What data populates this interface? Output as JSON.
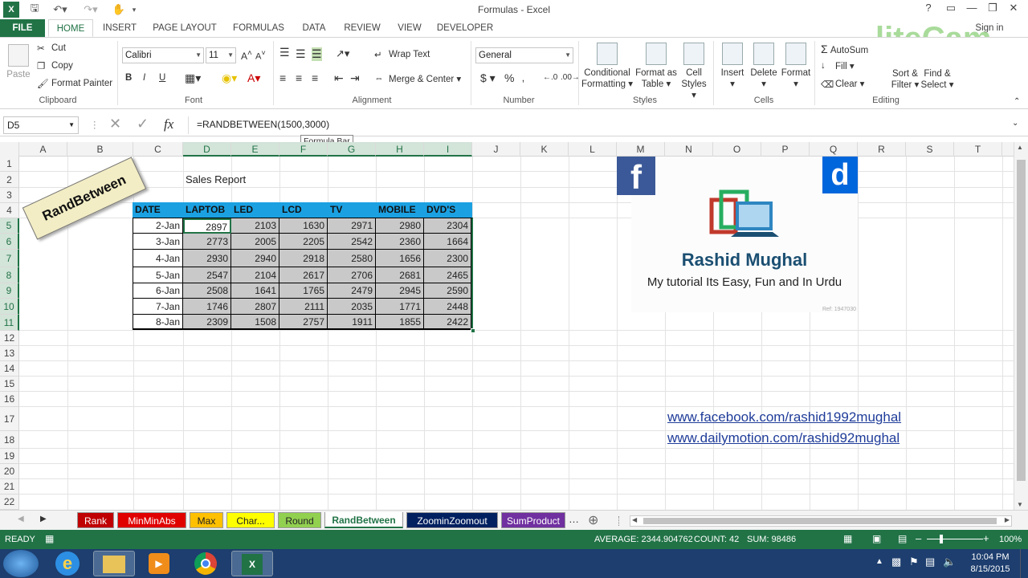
{
  "window": {
    "title": "Formulas - Excel",
    "signin": "Sign in"
  },
  "ribbon_tabs": [
    "FILE",
    "HOME",
    "INSERT",
    "PAGE LAYOUT",
    "FORMULAS",
    "DATA",
    "REVIEW",
    "VIEW",
    "DEVELOPER"
  ],
  "clipboard": {
    "paste": "Paste",
    "cut": "Cut",
    "copy": "Copy",
    "format_painter": "Format Painter",
    "label": "Clipboard"
  },
  "font": {
    "name": "Calibri",
    "size": "11",
    "label": "Font",
    "bold": "B",
    "italic": "I",
    "underline": "U"
  },
  "alignment": {
    "wrap": "Wrap Text",
    "merge": "Merge & Center",
    "label": "Alignment"
  },
  "number": {
    "format": "General",
    "label": "Number",
    "currency": "$",
    "percent": "%"
  },
  "styles": {
    "conditional": [
      "Conditional",
      "Formatting"
    ],
    "format_table": [
      "Format as",
      "Table"
    ],
    "cell_styles": [
      "Cell",
      "Styles"
    ],
    "label": "Styles"
  },
  "cells": {
    "insert": "Insert",
    "delete": "Delete",
    "format": "Format",
    "label": "Cells"
  },
  "editing": {
    "autosum": "AutoSum",
    "fill": "Fill",
    "clear": "Clear",
    "sort": [
      "Sort &",
      "Filter"
    ],
    "find": [
      "Find &",
      "Select"
    ],
    "label": "Editing"
  },
  "watermark": "liteCam",
  "formula_bar": {
    "name_box": "D5",
    "fx": "fx",
    "formula": "=RANDBETWEEN(1500,3000)",
    "tooltip": "Formula Bar"
  },
  "columns": [
    "A",
    "B",
    "C",
    "D",
    "E",
    "F",
    "G",
    "H",
    "I",
    "J",
    "K",
    "L",
    "M",
    "N",
    "O",
    "P",
    "Q",
    "R",
    "S",
    "T"
  ],
  "rows": [
    "1",
    "2",
    "3",
    "4",
    "5",
    "6",
    "7",
    "8",
    "9",
    "10",
    "11",
    "12",
    "13",
    "14",
    "15",
    "16",
    "17",
    "18",
    "19",
    "20",
    "21",
    "22"
  ],
  "sheet": {
    "title": "Sales Report",
    "stamp": "RandBetween",
    "headers": [
      "DATE",
      "LAPTOB",
      "LED",
      "LCD",
      "TV",
      "MOBILE",
      "DVD'S"
    ],
    "rows": [
      [
        "2-Jan",
        "2897",
        "2103",
        "1630",
        "2971",
        "2980",
        "2304"
      ],
      [
        "3-Jan",
        "2773",
        "2005",
        "2205",
        "2542",
        "2360",
        "1664"
      ],
      [
        "4-Jan",
        "2930",
        "2940",
        "2918",
        "2580",
        "1656",
        "2300"
      ],
      [
        "5-Jan",
        "2547",
        "2104",
        "2617",
        "2706",
        "2681",
        "2465"
      ],
      [
        "6-Jan",
        "2508",
        "1641",
        "1765",
        "2479",
        "2945",
        "2590"
      ],
      [
        "7-Jan",
        "1746",
        "2807",
        "2111",
        "2035",
        "1771",
        "2448"
      ],
      [
        "8-Jan",
        "2309",
        "1508",
        "2757",
        "1911",
        "1855",
        "2422"
      ]
    ],
    "links": [
      "www.facebook.com/rashid1992mughal",
      "www.dailymotion.com/rashid92mughal"
    ]
  },
  "logo": {
    "name": "Rashid Mughal",
    "tagline": "My tutorial Its Easy, Fun and In Urdu",
    "fb": "f",
    "dm": "d",
    "ref": "Ref: 1947030"
  },
  "sheet_tabs": [
    {
      "label": "Rank",
      "color": "#c00000"
    },
    {
      "label": "MinMinAbs",
      "color": "#e00000"
    },
    {
      "label": "Max",
      "color": "#ffc000"
    },
    {
      "label": "Char...",
      "color": "#ffff00"
    },
    {
      "label": "Round",
      "color": "#92d050"
    },
    {
      "label": "RandBetween",
      "color": "#ffffff"
    },
    {
      "label": "ZoominZoomout",
      "color": "#002060"
    },
    {
      "label": "SumProduct",
      "color": "#7030a0"
    }
  ],
  "status": {
    "ready": "READY",
    "average": "AVERAGE: 2344.904762",
    "count": "COUNT: 42",
    "sum": "SUM: 98486",
    "zoom": "100%"
  },
  "taskbar": {
    "time": "10:04 PM",
    "date": "8/15/2015"
  }
}
